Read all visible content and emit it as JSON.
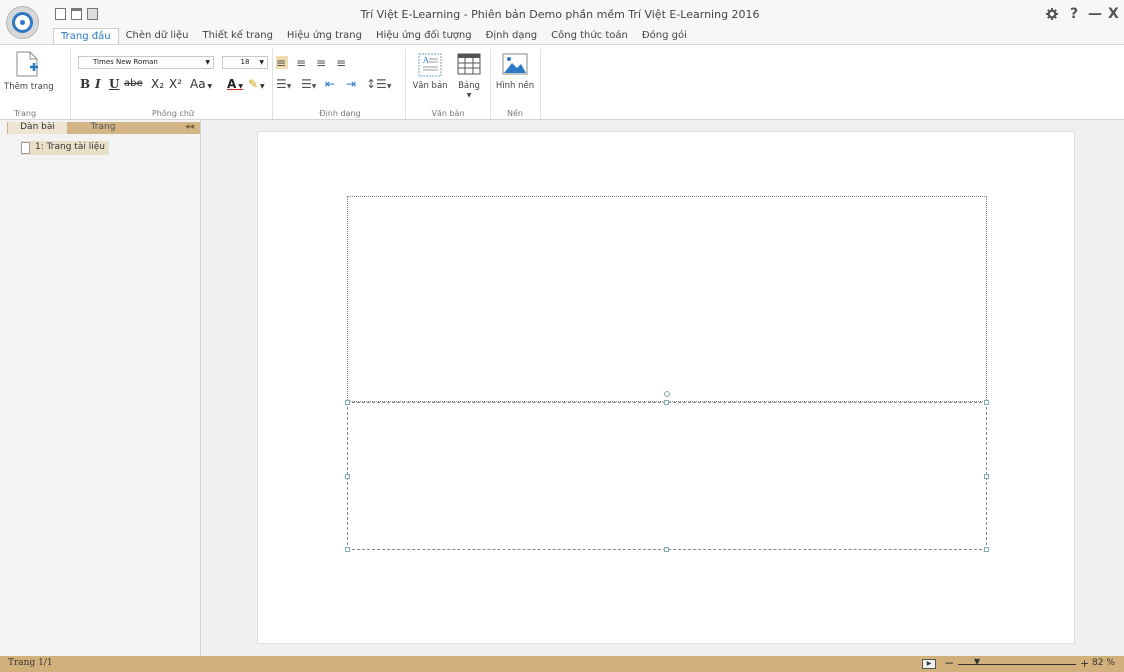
{
  "window": {
    "title": "Trí Việt E-Learning - Phiên bản Demo phần mềm Trí Việt E-Learning 2016",
    "settings_icon": "gear-icon",
    "help_label": "?",
    "minimize_label": "—",
    "close_label": "X"
  },
  "quick_access": [
    "new-document-icon",
    "open-icon",
    "save-icon"
  ],
  "tabs": [
    "Trang đầu",
    "Chèn dữ liệu",
    "Thiết kế trang",
    "Hiệu ứng trang",
    "Hiệu ứng đối tượng",
    "Định dạng",
    "Công thức toán",
    "Đóng gói"
  ],
  "active_tab": "Trang đầu",
  "ribbon": {
    "page_group": {
      "label": "Trang",
      "add_page": "Thêm trang"
    },
    "font_group": {
      "label": "Phông chữ",
      "font_name": "Times New Roman",
      "font_size": "18",
      "bold": "B",
      "italic": "I",
      "underline": "U",
      "strike": "abe",
      "subscript": "X₂",
      "superscript": "X²",
      "case": "Aa",
      "font_color": "A"
    },
    "paragraph_group": {
      "label": "Định dạng"
    },
    "text_group": {
      "label": "Văn bản",
      "textbox": "Văn bản",
      "table": "Bảng"
    },
    "background_group": {
      "label": "Nền",
      "background": "Hình nền"
    }
  },
  "outline_panel": {
    "tabs": [
      "Dàn bài",
      "Trang"
    ],
    "collapse_label": "◂◂",
    "items": [
      "1: Trang tài liệu"
    ]
  },
  "status": {
    "page_counter": "Trang 1/1",
    "zoom_minus": "−",
    "zoom_plus": "+",
    "zoom_level": "82 %"
  },
  "colors": {
    "accent": "#2b78c5",
    "panel_tan": "#d4b585",
    "status_tan": "#d2b07c"
  }
}
